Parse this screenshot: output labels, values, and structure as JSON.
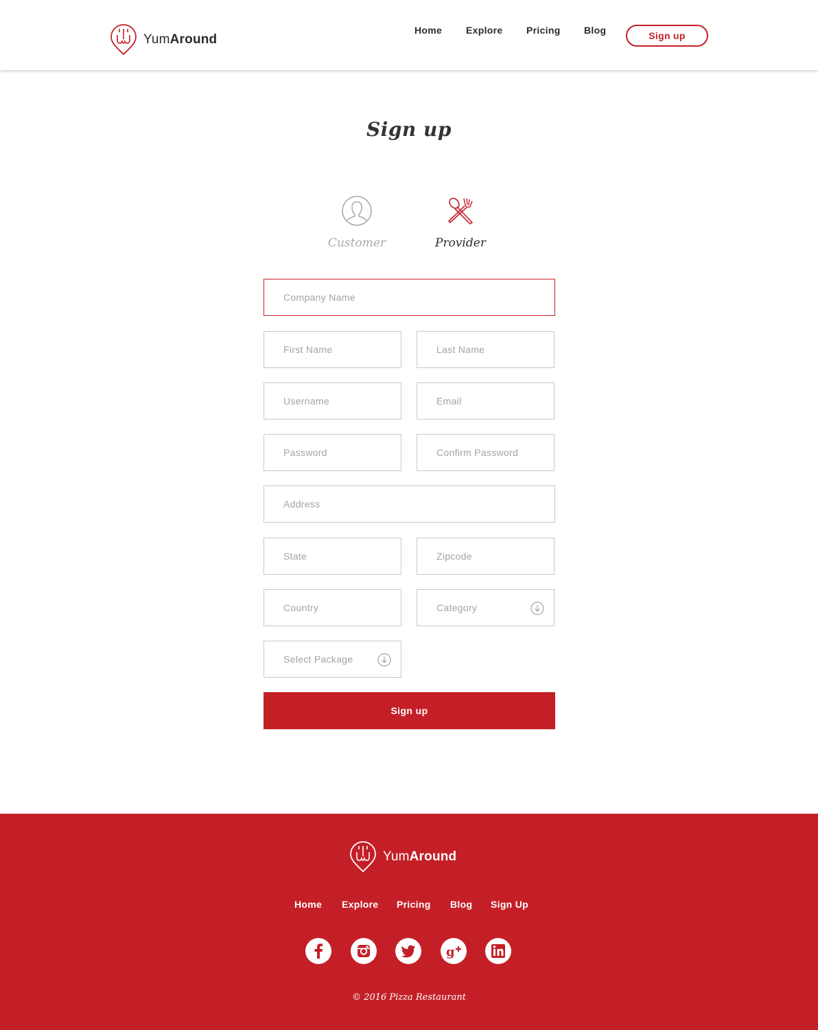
{
  "brand": {
    "light": "Yum",
    "bold": "Around"
  },
  "nav": {
    "home": "Home",
    "explore": "Explore",
    "pricing": "Pricing",
    "blog": "Blog",
    "signup": "Sign up"
  },
  "page": {
    "title": "Sign up"
  },
  "roles": {
    "customer": "Customer",
    "provider": "Provider",
    "selected": "Provider"
  },
  "form": {
    "company_name": "Company Name",
    "first_name": "First Name",
    "last_name": "Last Name",
    "username": "Username",
    "email": "Email",
    "password": "Password",
    "confirm_password": "Confirm Password",
    "address": "Address",
    "state": "State",
    "zipcode": "Zipcode",
    "country": "Country",
    "category": "Category",
    "select_package": "Select Package",
    "submit": "Sign up"
  },
  "footer": {
    "nav": {
      "home": "Home",
      "explore": "Explore",
      "pricing": "Pricing",
      "blog": "Blog",
      "signup": "Sign Up"
    },
    "social": [
      "facebook-icon",
      "instagram-icon",
      "twitter-icon",
      "google-plus-icon",
      "linkedin-icon"
    ],
    "copyright": "© 2016 Pizza Restaurant"
  },
  "colors": {
    "accent": "#c41f27",
    "border": "#c9c9c9",
    "placeholder": "#a3a3a3",
    "text": "#2b2b2b"
  }
}
